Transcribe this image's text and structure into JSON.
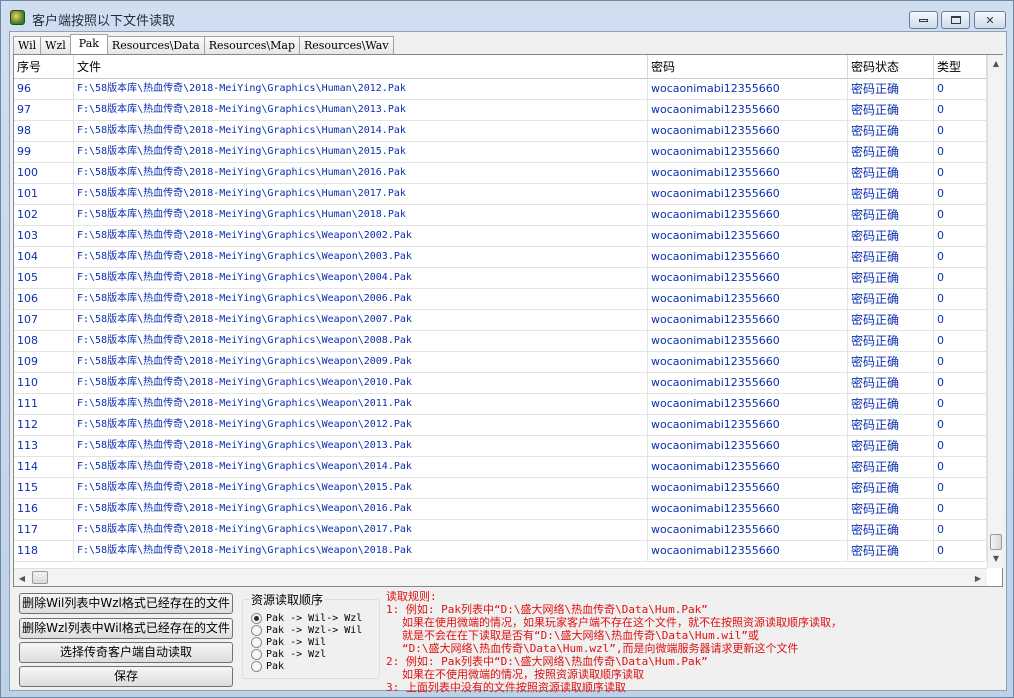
{
  "window": {
    "title": "客户端按照以下文件读取",
    "controls": {
      "minimize": "minimize-icon",
      "maximize": "maximize-icon",
      "close": "close-icon"
    }
  },
  "tabs": [
    "Wil",
    "Wzl",
    "Pak",
    "Resources\\Data",
    "Resources\\Map",
    "Resources\\Wav"
  ],
  "active_tab": "Pak",
  "table": {
    "columns": [
      "序号",
      "文件",
      "密码",
      "密码状态",
      "类型"
    ],
    "rows": [
      {
        "seq": "96",
        "path": "F:\\58版本库\\热血传奇\\2018-MeiYing\\Graphics\\Human\\2012.Pak",
        "password": "wocaonimabi12355660",
        "status": "密码正确",
        "type": "0"
      },
      {
        "seq": "97",
        "path": "F:\\58版本库\\热血传奇\\2018-MeiYing\\Graphics\\Human\\2013.Pak",
        "password": "wocaonimabi12355660",
        "status": "密码正确",
        "type": "0"
      },
      {
        "seq": "98",
        "path": "F:\\58版本库\\热血传奇\\2018-MeiYing\\Graphics\\Human\\2014.Pak",
        "password": "wocaonimabi12355660",
        "status": "密码正确",
        "type": "0"
      },
      {
        "seq": "99",
        "path": "F:\\58版本库\\热血传奇\\2018-MeiYing\\Graphics\\Human\\2015.Pak",
        "password": "wocaonimabi12355660",
        "status": "密码正确",
        "type": "0"
      },
      {
        "seq": "100",
        "path": "F:\\58版本库\\热血传奇\\2018-MeiYing\\Graphics\\Human\\2016.Pak",
        "password": "wocaonimabi12355660",
        "status": "密码正确",
        "type": "0"
      },
      {
        "seq": "101",
        "path": "F:\\58版本库\\热血传奇\\2018-MeiYing\\Graphics\\Human\\2017.Pak",
        "password": "wocaonimabi12355660",
        "status": "密码正确",
        "type": "0"
      },
      {
        "seq": "102",
        "path": "F:\\58版本库\\热血传奇\\2018-MeiYing\\Graphics\\Human\\2018.Pak",
        "password": "wocaonimabi12355660",
        "status": "密码正确",
        "type": "0"
      },
      {
        "seq": "103",
        "path": "F:\\58版本库\\热血传奇\\2018-MeiYing\\Graphics\\Weapon\\2002.Pak",
        "password": "wocaonimabi12355660",
        "status": "密码正确",
        "type": "0"
      },
      {
        "seq": "104",
        "path": "F:\\58版本库\\热血传奇\\2018-MeiYing\\Graphics\\Weapon\\2003.Pak",
        "password": "wocaonimabi12355660",
        "status": "密码正确",
        "type": "0"
      },
      {
        "seq": "105",
        "path": "F:\\58版本库\\热血传奇\\2018-MeiYing\\Graphics\\Weapon\\2004.Pak",
        "password": "wocaonimabi12355660",
        "status": "密码正确",
        "type": "0"
      },
      {
        "seq": "106",
        "path": "F:\\58版本库\\热血传奇\\2018-MeiYing\\Graphics\\Weapon\\2006.Pak",
        "password": "wocaonimabi12355660",
        "status": "密码正确",
        "type": "0"
      },
      {
        "seq": "107",
        "path": "F:\\58版本库\\热血传奇\\2018-MeiYing\\Graphics\\Weapon\\2007.Pak",
        "password": "wocaonimabi12355660",
        "status": "密码正确",
        "type": "0"
      },
      {
        "seq": "108",
        "path": "F:\\58版本库\\热血传奇\\2018-MeiYing\\Graphics\\Weapon\\2008.Pak",
        "password": "wocaonimabi12355660",
        "status": "密码正确",
        "type": "0"
      },
      {
        "seq": "109",
        "path": "F:\\58版本库\\热血传奇\\2018-MeiYing\\Graphics\\Weapon\\2009.Pak",
        "password": "wocaonimabi12355660",
        "status": "密码正确",
        "type": "0"
      },
      {
        "seq": "110",
        "path": "F:\\58版本库\\热血传奇\\2018-MeiYing\\Graphics\\Weapon\\2010.Pak",
        "password": "wocaonimabi12355660",
        "status": "密码正确",
        "type": "0"
      },
      {
        "seq": "111",
        "path": "F:\\58版本库\\热血传奇\\2018-MeiYing\\Graphics\\Weapon\\2011.Pak",
        "password": "wocaonimabi12355660",
        "status": "密码正确",
        "type": "0"
      },
      {
        "seq": "112",
        "path": "F:\\58版本库\\热血传奇\\2018-MeiYing\\Graphics\\Weapon\\2012.Pak",
        "password": "wocaonimabi12355660",
        "status": "密码正确",
        "type": "0"
      },
      {
        "seq": "113",
        "path": "F:\\58版本库\\热血传奇\\2018-MeiYing\\Graphics\\Weapon\\2013.Pak",
        "password": "wocaonimabi12355660",
        "status": "密码正确",
        "type": "0"
      },
      {
        "seq": "114",
        "path": "F:\\58版本库\\热血传奇\\2018-MeiYing\\Graphics\\Weapon\\2014.Pak",
        "password": "wocaonimabi12355660",
        "status": "密码正确",
        "type": "0"
      },
      {
        "seq": "115",
        "path": "F:\\58版本库\\热血传奇\\2018-MeiYing\\Graphics\\Weapon\\2015.Pak",
        "password": "wocaonimabi12355660",
        "status": "密码正确",
        "type": "0"
      },
      {
        "seq": "116",
        "path": "F:\\58版本库\\热血传奇\\2018-MeiYing\\Graphics\\Weapon\\2016.Pak",
        "password": "wocaonimabi12355660",
        "status": "密码正确",
        "type": "0"
      },
      {
        "seq": "117",
        "path": "F:\\58版本库\\热血传奇\\2018-MeiYing\\Graphics\\Weapon\\2017.Pak",
        "password": "wocaonimabi12355660",
        "status": "密码正确",
        "type": "0"
      },
      {
        "seq": "118",
        "path": "F:\\58版本库\\热血传奇\\2018-MeiYing\\Graphics\\Weapon\\2018.Pak",
        "password": "wocaonimabi12355660",
        "status": "密码正确",
        "type": "0"
      }
    ]
  },
  "buttons": {
    "delete_wil": "删除Wil列表中Wzl格式已经存在的文件",
    "delete_wzl": "删除Wzl列表中Wil格式已经存在的文件",
    "auto_read": "选择传奇客户端自动读取",
    "save": "保存"
  },
  "resource_order": {
    "title": "资源读取顺序",
    "options": [
      "Pak -> Wil-> Wzl",
      "Pak -> Wzl-> Wil",
      "Pak -> Wil",
      "Pak -> Wzl",
      "Pak"
    ],
    "selected": "Pak -> Wil-> Wzl"
  },
  "rules": [
    "读取规则:",
    "1: 例如: Pak列表中“D:\\盛大网络\\热血传奇\\Data\\Hum.Pak”",
    "如果在使用微端的情况，如果玩家客户端不存在这个文件，就不在按照资源读取顺序读取，",
    "就是不会在在下读取是否有“D:\\盛大网络\\热血传奇\\Data\\Hum.wil”或",
    "“D:\\盛大网络\\热血传奇\\Data\\Hum.wzl”,而是向微端服务器请求更新这个文件",
    "2: 例如: Pak列表中“D:\\盛大网络\\热血传奇\\Data\\Hum.Pak”",
    "如果在不使用微端的情况，按照资源读取顺序读取",
    "3: 上面列表中没有的文件按照资源读取顺序读取"
  ],
  "colors": {
    "link_text": "#0b2fb0",
    "rules_text": "#e01010",
    "title_bar": "#c4d6ea"
  }
}
